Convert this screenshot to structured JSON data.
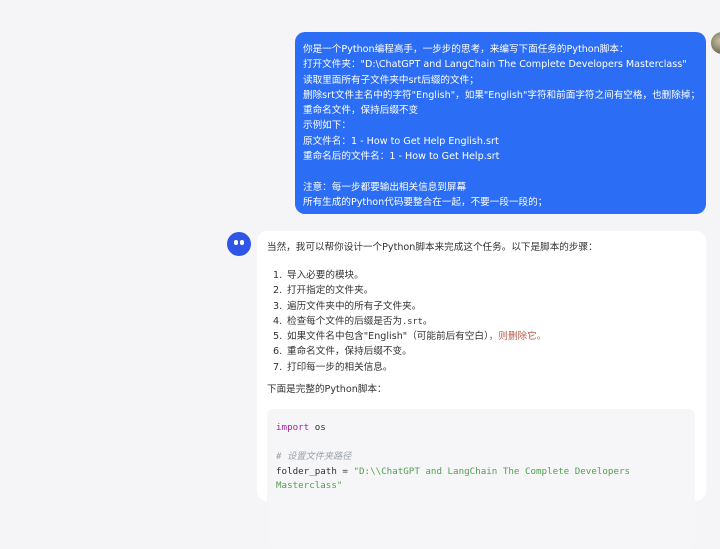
{
  "user_message": {
    "lines": [
      "你是一个Python编程高手，一步步的思考，来编写下面任务的Python脚本：",
      "打开文件夹：\"D:\\ChatGPT and LangChain The Complete Developers Masterclass\"",
      "读取里面所有子文件夹中srt后缀的文件；",
      "删除srt文件主名中的字符\"English\"，如果\"English\"字符和前面字符之间有空格，也删除掉；",
      "重命名文件，保持后缀不变",
      "示例如下：",
      "原文件名：1 - How to Get Help English.srt",
      "重命名后的文件名：1 - How to Get Help.srt",
      "",
      "注意：每一步都要输出相关信息到屏幕",
      "所有生成的Python代码要整合在一起，不要一段一段的；"
    ]
  },
  "assistant_message": {
    "intro": "当然，我可以帮你设计一个Python脚本来完成这个任务。以下是脚本的步骤：",
    "steps": [
      {
        "num": "1.",
        "text": "导入必要的模块。"
      },
      {
        "num": "2.",
        "text": "打开指定的文件夹。"
      },
      {
        "num": "3.",
        "text": "遍历文件夹中的所有子文件夹。"
      },
      {
        "num": "4.",
        "text_before": "检查每个文件的后缀是否为",
        "code": ".srt",
        "text_after": "。"
      },
      {
        "num": "5.",
        "text_before": "如果文件名中包含\"English\"（可能前后有空白）",
        "text_after": "，则删除它。"
      },
      {
        "num": "6.",
        "text": "重命名文件，保持后缀不变。"
      },
      {
        "num": "7.",
        "text": "打印每一步的相关信息。"
      }
    ],
    "outro": "下面是完整的Python脚本：",
    "code": {
      "line1_kw": "import",
      "line1_rest": " os",
      "comment": "# 设置文件夹路径",
      "var": "folder_path",
      "eq": " = ",
      "str_line1": "\"D:\\\\ChatGPT and LangChain The Complete Developers",
      "str_line2": "Masterclass\""
    }
  },
  "colors": {
    "user_bubble": "#2b6df5",
    "bot_avatar": "#2e55e6",
    "background": "#f5f5f7"
  }
}
